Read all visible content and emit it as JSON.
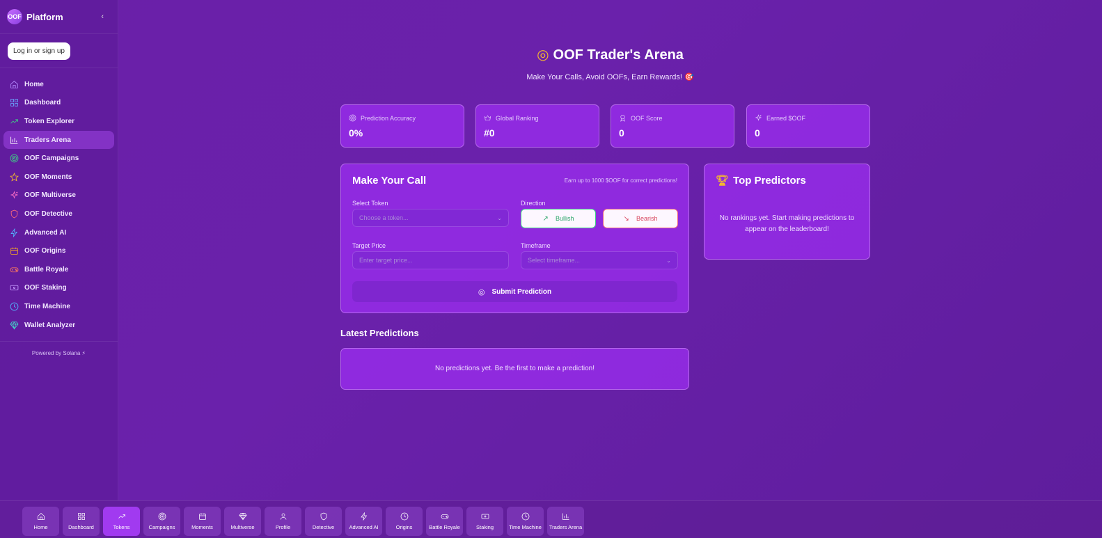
{
  "sidebar": {
    "brand_logo": "OOF",
    "brand_name": "Platform",
    "collapse_icon": "‹",
    "login_label": "Log in or sign up",
    "items": [
      {
        "label": "Home",
        "icon": "home-icon",
        "color": "#b58bff"
      },
      {
        "label": "Dashboard",
        "icon": "grid-icon",
        "color": "#6aa8ff"
      },
      {
        "label": "Token Explorer",
        "icon": "trending-up-icon",
        "color": "#3fcf86"
      },
      {
        "label": "Traders Arena",
        "icon": "bar-chart-icon",
        "color": "#ffffff",
        "active": true
      },
      {
        "label": "OOF Campaigns",
        "icon": "target-icon",
        "color": "#3fcf86"
      },
      {
        "label": "OOF Moments",
        "icon": "star-icon",
        "color": "#f5b92e"
      },
      {
        "label": "OOF Multiverse",
        "icon": "sparkles-icon",
        "color": "#ff6ec7"
      },
      {
        "label": "OOF Detective",
        "icon": "shield-icon",
        "color": "#ff6a7a"
      },
      {
        "label": "Advanced AI",
        "icon": "zap-icon",
        "color": "#52b6ff"
      },
      {
        "label": "OOF Origins",
        "icon": "calendar-icon",
        "color": "#f5a623"
      },
      {
        "label": "Battle Royale",
        "icon": "gamepad-icon",
        "color": "#ff7a5c"
      },
      {
        "label": "OOF Staking",
        "icon": "ticket-icon",
        "color": "#c79bff"
      },
      {
        "label": "Time Machine",
        "icon": "clock-icon",
        "color": "#52b6ff"
      },
      {
        "label": "Wallet Analyzer",
        "icon": "gem-icon",
        "color": "#40e0c8"
      }
    ],
    "powered_by": "Powered by Solana ⚡"
  },
  "hero": {
    "title": "OOF Trader's Arena",
    "subtitle": "Make Your Calls, Avoid OOFs, Earn Rewards! 🎯"
  },
  "stats": [
    {
      "label": "Prediction Accuracy",
      "value": "0%",
      "icon": "target-icon"
    },
    {
      "label": "Global Ranking",
      "value": "#0",
      "icon": "crown-icon"
    },
    {
      "label": "OOF Score",
      "value": "0",
      "icon": "award-icon"
    },
    {
      "label": "Earned $OOF",
      "value": "0",
      "icon": "sparkles-icon"
    }
  ],
  "call": {
    "title": "Make Your Call",
    "note": "Earn up to 1000 $OOF for correct predictions!",
    "token_label": "Select Token",
    "token_placeholder": "Choose a token...",
    "direction_label": "Direction",
    "bullish": "Bullish",
    "bearish": "Bearish",
    "price_label": "Target Price",
    "price_placeholder": "Enter target price...",
    "timeframe_label": "Timeframe",
    "timeframe_placeholder": "Select timeframe...",
    "submit": "Submit Prediction"
  },
  "top": {
    "title": "Top Predictors",
    "empty": "No rankings yet. Start making predictions to appear on the leaderboard!"
  },
  "latest": {
    "title": "Latest Predictions",
    "empty": "No predictions yet. Be the first to make a prediction!"
  },
  "bottombar": {
    "items": [
      {
        "label": "Home",
        "icon": "home-icon"
      },
      {
        "label": "Dashboard",
        "icon": "grid-icon"
      },
      {
        "label": "Tokens",
        "icon": "trending-up-icon",
        "active": true
      },
      {
        "label": "Campaigns",
        "icon": "target-icon"
      },
      {
        "label": "Moments",
        "icon": "calendar-icon"
      },
      {
        "label": "Multiverse",
        "icon": "gem-icon"
      },
      {
        "label": "Profile",
        "icon": "user-icon"
      },
      {
        "label": "Detective",
        "icon": "shield-icon"
      },
      {
        "label": "Advanced AI",
        "icon": "zap-icon"
      },
      {
        "label": "Origins",
        "icon": "clock-icon"
      },
      {
        "label": "Battle Royale",
        "icon": "gamepad-icon"
      },
      {
        "label": "Staking",
        "icon": "ticket-icon"
      },
      {
        "label": "Time Machine",
        "icon": "clock-icon"
      },
      {
        "label": "Traders Arena",
        "icon": "bar-chart-icon"
      }
    ]
  }
}
